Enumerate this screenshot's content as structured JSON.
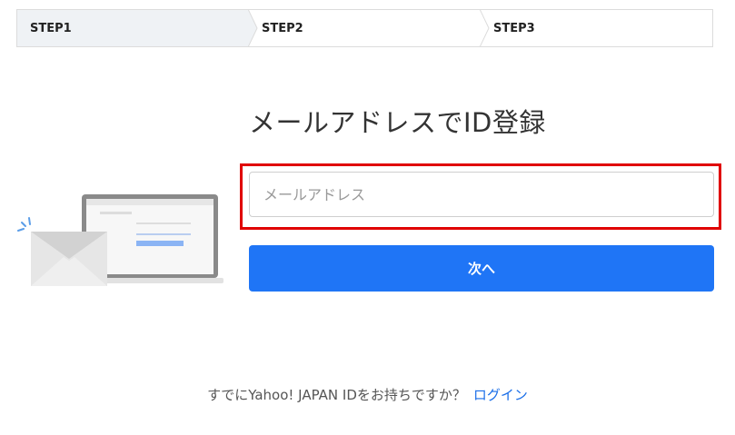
{
  "steps": [
    {
      "label": "STEP1",
      "active": true
    },
    {
      "label": "STEP2",
      "active": false
    },
    {
      "label": "STEP3",
      "active": false
    }
  ],
  "main": {
    "title": "メールアドレスでID登録",
    "email_placeholder": "メールアドレス",
    "email_value": "",
    "next_label": "次へ"
  },
  "illustration": {
    "icons": [
      "laptop-icon",
      "envelope-icon"
    ]
  },
  "footer": {
    "question": "すでにYahoo! JAPAN IDをお持ちですか？",
    "login_label": "ログイン"
  },
  "colors": {
    "accent": "#1f75f6",
    "highlight": "#e00000",
    "link": "#1a6ee8",
    "step_active_bg": "#eff2f5"
  }
}
